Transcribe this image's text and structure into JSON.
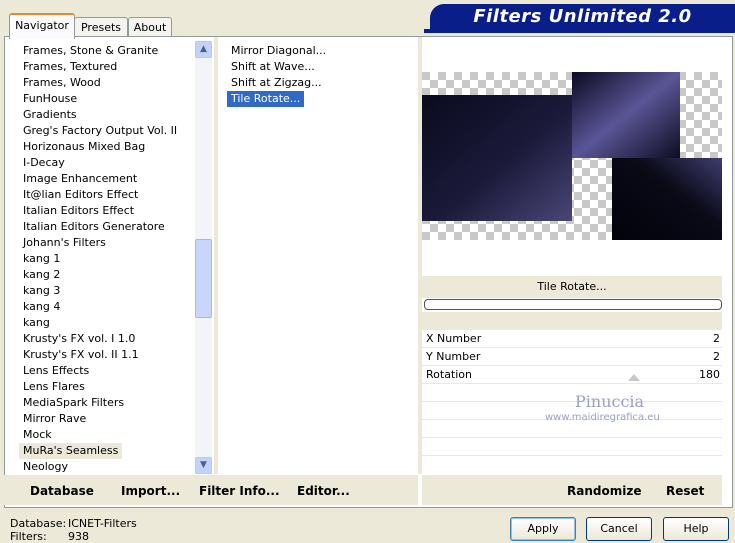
{
  "header": {
    "title": "Filters Unlimited 2.0"
  },
  "tabs": [
    {
      "label": "Navigator",
      "active": true
    },
    {
      "label": "Presets",
      "active": false
    },
    {
      "label": "About",
      "active": false
    }
  ],
  "categories": [
    "Frames, Stone & Granite",
    "Frames, Textured",
    "Frames, Wood",
    "FunHouse",
    "Gradients",
    "Greg's Factory Output Vol. II",
    "Horizonaus Mixed Bag",
    "I-Decay",
    "Image Enhancement",
    "It@lian Editors Effect",
    "Italian Editors Effect",
    "Italian Editors Generatore",
    "Johann's Filters",
    "kang 1",
    "kang 2",
    "kang 3",
    "kang 4",
    "kang",
    "Krusty's FX vol. I 1.0",
    "Krusty's FX vol. II 1.1",
    "Lens Effects",
    "Lens Flares",
    "MediaSpark Filters",
    "Mirror Rave",
    "Mock",
    "MuRa's Seamless",
    "Neology"
  ],
  "selected_category": "MuRa's Seamless",
  "filters": [
    "Mirror Diagonal...",
    "Shift at Wave...",
    "Shift at Zigzag...",
    "Tile Rotate..."
  ],
  "selected_filter": "Tile Rotate...",
  "preview": {
    "filter_name": "Tile Rotate...",
    "progress": 0
  },
  "params": [
    {
      "label": "X Number",
      "value": "2"
    },
    {
      "label": "Y Number",
      "value": "2"
    },
    {
      "label": "Rotation",
      "value": "180"
    }
  ],
  "watermark": {
    "name": "Pinuccia",
    "url": "www.maidiregrafica.eu"
  },
  "toolbar": {
    "database": "Database",
    "import": "Import...",
    "filter_info": "Filter Info...",
    "editor": "Editor...",
    "randomize": "Randomize",
    "reset": "Reset"
  },
  "status": {
    "database_label": "Database:",
    "database_value": "ICNET-Filters",
    "filters_label": "Filters:",
    "filters_value": "938"
  },
  "buttons": {
    "apply": "Apply",
    "cancel": "Cancel",
    "help": "Help"
  },
  "colors": {
    "banner": "#0a1e8a",
    "selection": "#316ac5",
    "tab_accent": "#e68b2c"
  }
}
